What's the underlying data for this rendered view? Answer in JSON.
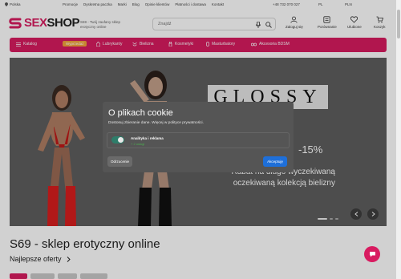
{
  "topbar": {
    "location": "Polska",
    "links": [
      "Promocje",
      "Dyskretna paczka",
      "Marki",
      "Blog",
      "Opinie klientów",
      "Płatności i dostawa",
      "Kontakt"
    ],
    "phone": "+48 732 070 027",
    "language": "PL",
    "currency": "PLN"
  },
  "header": {
    "logo_part1": "SEX",
    "logo_part2": "SHOP",
    "tagline": "S69 - Twój zaufany sklep erotyczny online",
    "search_placeholder": "Znajdź",
    "icons": {
      "account": "Zaloguj się",
      "compare": "Porównanie",
      "favorites": "Ulubione",
      "cart": "Koszyk"
    }
  },
  "nav": {
    "catalog": "Katalog",
    "wyprzedaz": "Wyprzedaż",
    "items": [
      "Lubrykanty",
      "Bielizna",
      "Kosmetyki",
      "Masturbatory",
      "Akcesoria BDSM"
    ]
  },
  "hero": {
    "brand": "GLOSSY",
    "percent": "-15%",
    "subtitle_line1": "Rabat na długo wyczekiwaną",
    "subtitle_line2": "oczekiwaną kolekcją bielizny"
  },
  "cookie": {
    "title": "O plikach cookie",
    "desc": "Dostosuj zbieranie dane. Więcej w polityce prywatności.",
    "consent_label": "Analityka i reklama",
    "consent_more": "+ 2 usługi",
    "reject": "Odrzucenie",
    "accept": "Akceptuję"
  },
  "page": {
    "heading": "S69 - sklep erotyczny online",
    "best": "Najlepsze oferty"
  },
  "colors": {
    "brand": "#d81b60",
    "accent": "#f3a43b",
    "accept": "#1e6fd9"
  }
}
